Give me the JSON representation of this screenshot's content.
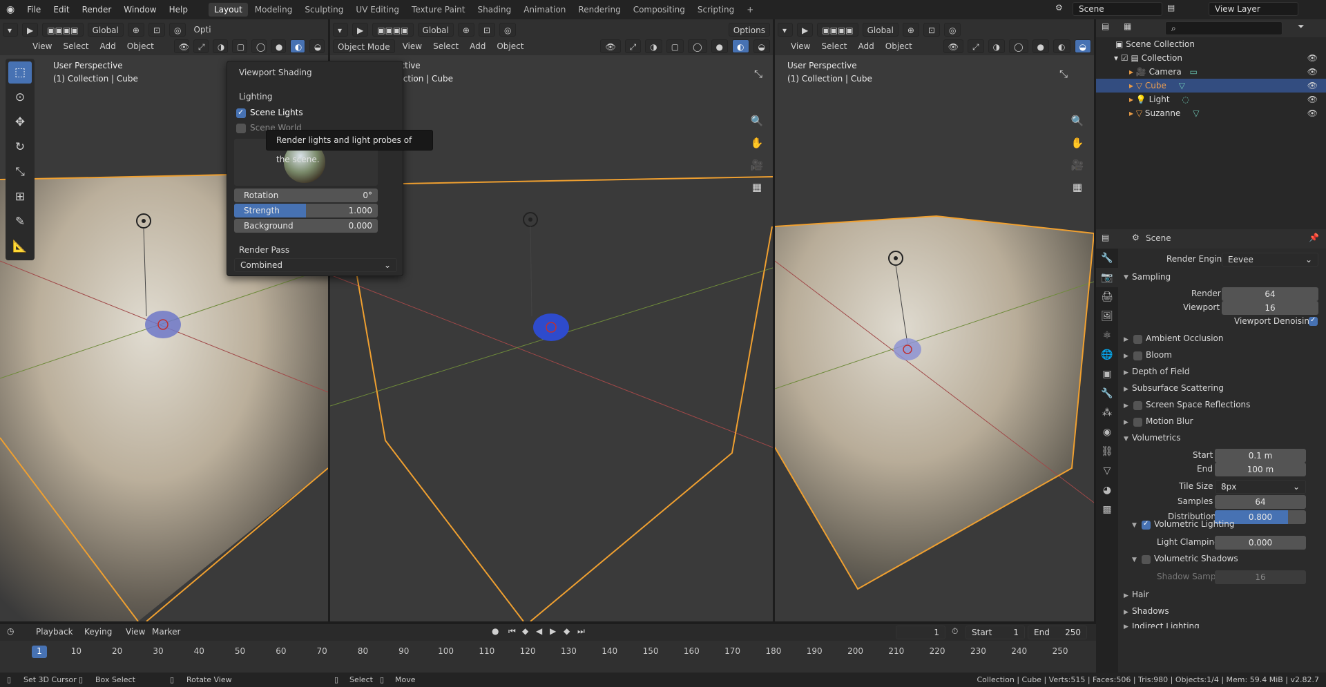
{
  "menubar": {
    "items": [
      "File",
      "Edit",
      "Render",
      "Window",
      "Help"
    ],
    "workspaces": [
      "Layout",
      "Modeling",
      "Sculpting",
      "UV Editing",
      "Texture Paint",
      "Shading",
      "Animation",
      "Rendering",
      "Compositing",
      "Scripting"
    ],
    "active_workspace": "Layout",
    "scene": "Scene",
    "view_layer": "View Layer"
  },
  "viewport_left": {
    "menu": [
      "View",
      "Select",
      "Add",
      "Object"
    ],
    "transform": "Global",
    "options": "Opti",
    "perspective": "User Perspective",
    "collection": "(1) Collection | Cube"
  },
  "viewport_mid": {
    "mode": "Object Mode",
    "menu": [
      "View",
      "Select",
      "Add",
      "Object"
    ],
    "transform": "Global",
    "options": "Options",
    "perspective": "erspective",
    "collection": "Collection | Cube"
  },
  "viewport_right": {
    "menu": [
      "View",
      "Select",
      "Add",
      "Object"
    ],
    "transform": "Global",
    "perspective": "User Perspective",
    "collection": "(1) Collection | Cube"
  },
  "shading_popover": {
    "title": "Viewport Shading",
    "lighting_heading": "Lighting",
    "scene_lights_label": "Scene Lights",
    "scene_lights_checked": true,
    "scene_world_label": "Scene World",
    "scene_world_checked": false,
    "rotation_label": "Rotation",
    "rotation_value": "0°",
    "strength_label": "Strength",
    "strength_value": "1.000",
    "strength_fill": 0.5,
    "background_label": "Background",
    "background_value": "0.000",
    "render_pass_heading": "Render Pass",
    "render_pass_value": "Combined"
  },
  "tooltip": "Render lights and light probes of the scene.",
  "outliner": {
    "root": "Scene Collection",
    "collection": "Collection",
    "objects": [
      {
        "name": "Camera",
        "selected": false
      },
      {
        "name": "Cube",
        "selected": true
      },
      {
        "name": "Light",
        "selected": false
      },
      {
        "name": "Suzanne",
        "selected": false
      }
    ]
  },
  "properties": {
    "context": "Scene",
    "render_engine_label": "Render Engine",
    "render_engine": "Eevee",
    "sampling": "Sampling",
    "render_label": "Render",
    "render_samples": "64",
    "viewport_label": "Viewport",
    "viewport_samples": "16",
    "viewport_denoising": "Viewport Denoising",
    "panels": [
      "Ambient Occlusion",
      "Bloom",
      "Depth of Field",
      "Subsurface Scattering",
      "Screen Space Reflections",
      "Motion Blur"
    ],
    "volumetrics": "Volumetrics",
    "start_label": "Start",
    "start_value": "0.1 m",
    "end_label": "End",
    "end_value": "100 m",
    "tile_size_label": "Tile Size",
    "tile_size_value": "8px",
    "samples_label": "Samples",
    "samples_value": "64",
    "distribution_label": "Distribution",
    "distribution_value": "0.800",
    "distribution_fill": 0.8,
    "volumetric_lighting": "Volumetric Lighting",
    "light_clamping_label": "Light Clamping",
    "light_clamping_value": "0.000",
    "volumetric_shadows": "Volumetric Shadows",
    "shadow_samples_label": "Shadow Samples",
    "shadow_samples_value": "16",
    "hair": "Hair",
    "shadows": "Shadows",
    "indirect_lighting": "Indirect Lighting"
  },
  "timeline": {
    "menu": [
      "Playback",
      "Keying",
      "View",
      "Marker"
    ],
    "current_frame": "1",
    "start_label": "Start",
    "start": "1",
    "end_label": "End",
    "end": "250",
    "ticks": [
      "1",
      "10",
      "20",
      "30",
      "40",
      "50",
      "60",
      "70",
      "80",
      "90",
      "100",
      "110",
      "120",
      "130",
      "140",
      "150",
      "160",
      "170",
      "180",
      "190",
      "200",
      "210",
      "220",
      "230",
      "240",
      "250"
    ]
  },
  "statusbar": {
    "hint1": "Set 3D Cursor",
    "hint2": "Box Select",
    "hint3": "Rotate View",
    "hint4": "Select",
    "hint5": "Move",
    "stats": "Collection | Cube | Verts:515 | Faces:506 | Tris:980 | Objects:1/4 | Mem: 59.4 MiB | v2.82.7"
  }
}
